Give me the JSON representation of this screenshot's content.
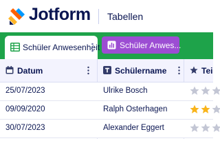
{
  "header": {
    "brand": "Jotform",
    "section_title": "Tabellen"
  },
  "tabs": [
    {
      "label": "Schüler Anwesenheit",
      "icon": "table-grid-icon",
      "active": true
    },
    {
      "label": "Schüler Anwes...",
      "icon": "report-chart-icon",
      "active": false
    }
  ],
  "table": {
    "columns": [
      {
        "label": "Datum",
        "icon": "calendar-icon"
      },
      {
        "label": "Schülername",
        "icon": "text-type-icon"
      },
      {
        "label": "Teiln",
        "icon": "star-icon"
      }
    ],
    "rows": [
      {
        "date": "25/07/2023",
        "name": "Ulrike Bosch",
        "rating": 0
      },
      {
        "date": "09/09/2020",
        "name": "Ralph Osterhagen",
        "rating": 2
      },
      {
        "date": "30/07/2023",
        "name": "Alexander Eggert",
        "rating": 0
      }
    ]
  },
  "colors": {
    "tab_bar": "#1ea34a",
    "report_tab": "#9c4dd3",
    "star_filled": "#f9b41b",
    "star_empty": "#c3c6d4",
    "text": "#0a1551"
  }
}
